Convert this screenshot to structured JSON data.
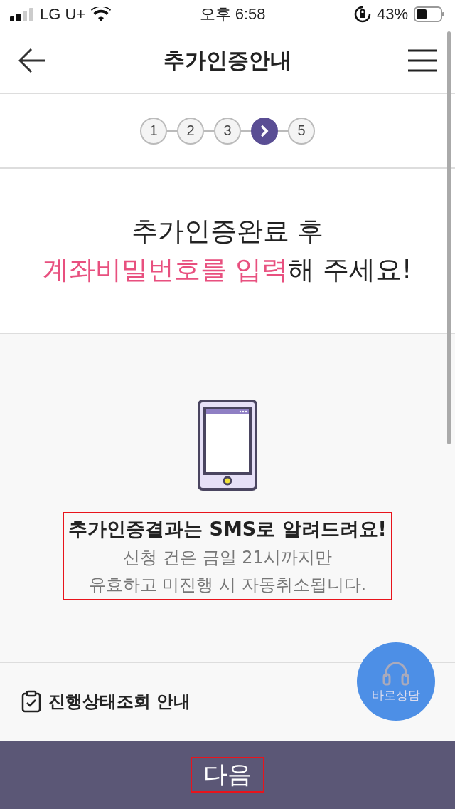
{
  "status_bar": {
    "carrier": "LG U+",
    "time": "오후 6:58",
    "battery": "43%"
  },
  "header": {
    "title": "추가인증안내"
  },
  "steps": [
    {
      "label": "1",
      "selected": false
    },
    {
      "label": "2",
      "selected": false
    },
    {
      "label": "3",
      "selected": false
    },
    {
      "selected": true
    },
    {
      "label": "5",
      "selected": false
    }
  ],
  "headline": {
    "line_1": "추가인증완료 후",
    "highlight": "계좌비밀번호를 입력",
    "rest": "해 주세요!"
  },
  "notice": {
    "title": "추가인증결과는 SMS로 알려드려요!",
    "lines": [
      "신청 건은 금일 21시까지만",
      "유효하고 미진행 시 자동취소됩니다."
    ],
    "annotated": true
  },
  "status_link": {
    "label": "진행상태조회 안내"
  },
  "consult_button": {
    "label": "바로상담"
  },
  "next_button": {
    "label": "다음",
    "annotated": true
  }
}
